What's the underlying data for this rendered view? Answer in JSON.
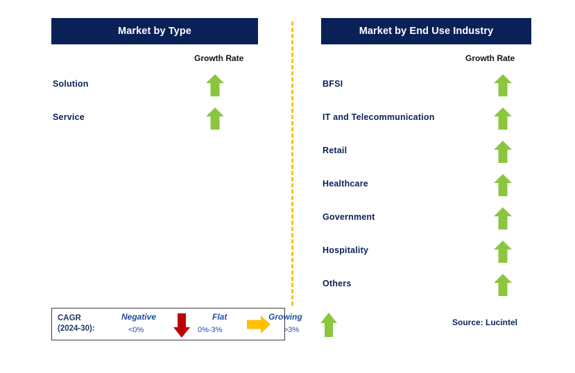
{
  "colors": {
    "navy": "#0A2158",
    "green": "#8CC63F",
    "red": "#C00000",
    "orange": "#FFC000",
    "legend_text": "#1F4E9C"
  },
  "panels": [
    {
      "id": "type",
      "title": "Market by Type",
      "growth_rate_label": "Growth Rate",
      "rows": [
        {
          "label": "Solution",
          "growth": "growing",
          "arrow_icon": "arrow-up-icon"
        },
        {
          "label": "Service",
          "growth": "growing",
          "arrow_icon": "arrow-up-icon"
        }
      ]
    },
    {
      "id": "end_use",
      "title": "Market by End Use Industry",
      "growth_rate_label": "Growth Rate",
      "rows": [
        {
          "label": "BFSI",
          "growth": "growing",
          "arrow_icon": "arrow-up-icon"
        },
        {
          "label": "IT and Telecommunication",
          "growth": "growing",
          "arrow_icon": "arrow-up-icon"
        },
        {
          "label": "Retail",
          "growth": "growing",
          "arrow_icon": "arrow-up-icon"
        },
        {
          "label": "Healthcare",
          "growth": "growing",
          "arrow_icon": "arrow-up-icon"
        },
        {
          "label": "Government",
          "growth": "growing",
          "arrow_icon": "arrow-up-icon"
        },
        {
          "label": "Hospitality",
          "growth": "growing",
          "arrow_icon": "arrow-up-icon"
        },
        {
          "label": "Others",
          "growth": "growing",
          "arrow_icon": "arrow-up-icon"
        }
      ]
    }
  ],
  "legend": {
    "title_line1": "CAGR",
    "title_line2": "(2024-30):",
    "items": [
      {
        "name": "Negative",
        "range": "<0%",
        "arrow_icon": "arrow-down-icon",
        "color": "#C00000"
      },
      {
        "name": "Flat",
        "range": "0%-3%",
        "arrow_icon": "arrow-right-icon",
        "color": "#FFC000"
      },
      {
        "name": "Growing",
        "range": ">3%",
        "arrow_icon": "arrow-up-icon",
        "color": "#8CC63F"
      }
    ]
  },
  "source": "Source: Lucintel"
}
